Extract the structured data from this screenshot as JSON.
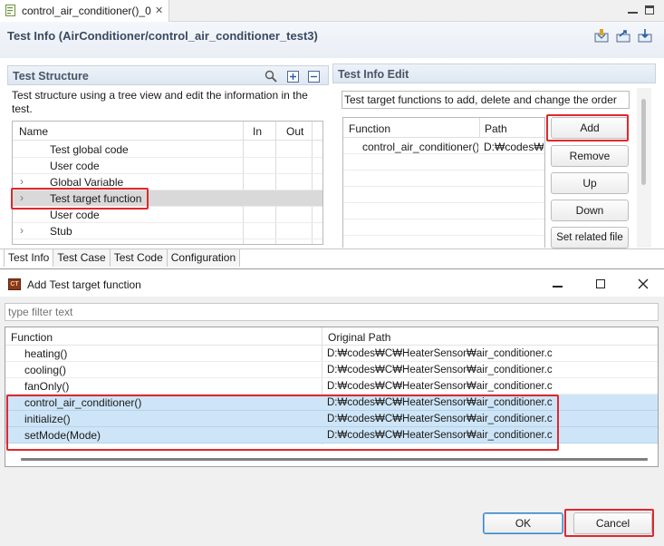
{
  "editor": {
    "tab_label": "control_air_conditioner()_0",
    "close_glyph": "✕",
    "title": "Test Info (AirConditioner/control_air_conditioner_test3)"
  },
  "structure": {
    "title": "Test Structure",
    "description": "Test structure using a tree view and edit the information in the test.",
    "columns": [
      "Name",
      "In",
      "Out"
    ],
    "rows": [
      {
        "label": "Test global code",
        "expandable": false,
        "selected": false
      },
      {
        "label": "User code",
        "expandable": false,
        "selected": false
      },
      {
        "label": "Global Variable",
        "expandable": true,
        "selected": false
      },
      {
        "label": "Test target function",
        "expandable": true,
        "selected": true
      },
      {
        "label": "User code",
        "expandable": false,
        "selected": false
      },
      {
        "label": "Stub",
        "expandable": true,
        "selected": false
      }
    ]
  },
  "edit": {
    "title": "Test Info Edit",
    "hint": "Test target functions to add, delete and change the order",
    "columns": [
      "Function",
      "Path"
    ],
    "rows": [
      {
        "function": "control_air_conditioner()",
        "path": "D:₩codes₩C"
      }
    ],
    "buttons": [
      "Add",
      "Remove",
      "Up",
      "Down",
      "Set related file"
    ]
  },
  "bottom_tabs": [
    "Test Info",
    "Test Case",
    "Test Code",
    "Configuration"
  ],
  "dialog": {
    "icon_text": "CT",
    "title": "Add Test target function",
    "filter_placeholder": "type filter text",
    "columns": [
      "Function",
      "Original Path"
    ],
    "rows": [
      {
        "function": "heating()",
        "path": "D:₩codes₩C₩HeaterSensor₩air_conditioner.c",
        "selected": false
      },
      {
        "function": "cooling()",
        "path": "D:₩codes₩C₩HeaterSensor₩air_conditioner.c",
        "selected": false
      },
      {
        "function": "fanOnly()",
        "path": "D:₩codes₩C₩HeaterSensor₩air_conditioner.c",
        "selected": false
      },
      {
        "function": "control_air_conditioner()",
        "path": "D:₩codes₩C₩HeaterSensor₩air_conditioner.c",
        "selected": true
      },
      {
        "function": "initialize()",
        "path": "D:₩codes₩C₩HeaterSensor₩air_conditioner.c",
        "selected": true
      },
      {
        "function": "setMode(Mode)",
        "path": "D:₩codes₩C₩HeaterSensor₩air_conditioner.c",
        "selected": true
      }
    ],
    "ok_label": "OK",
    "cancel_label": "Cancel"
  },
  "colors": {
    "highlight_red": "#e0272e",
    "dialog_selection": "#cde5f7",
    "tree_selection": "#d9d9d9",
    "header_text": "#3a4a60"
  }
}
